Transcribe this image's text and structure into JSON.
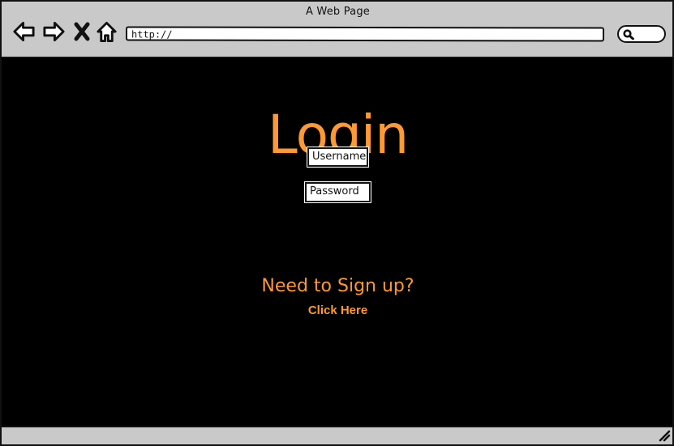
{
  "window": {
    "title": "A Web Page"
  },
  "browser": {
    "url": "http://",
    "icons": {
      "back": "back-arrow-icon",
      "forward": "forward-arrow-icon",
      "stop": "close-icon",
      "home": "home-icon",
      "search": "search-icon",
      "resize": "resize-grip-icon"
    }
  },
  "main": {
    "title": "Login",
    "username_placeholder": "Username",
    "password_placeholder": "Password",
    "signup_text": "Need to Sign up?",
    "signup_link": "Click Here"
  },
  "colors": {
    "accent": "#ff9933",
    "background": "#000000",
    "chrome": "#c9c9c9"
  }
}
